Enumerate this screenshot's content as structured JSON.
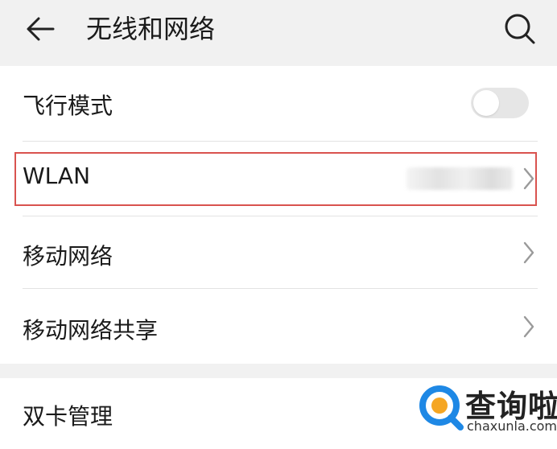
{
  "header": {
    "title": "无线和网络",
    "back_icon": "arrow-left-icon",
    "search_icon": "search-icon"
  },
  "settings": {
    "items": [
      {
        "label": "飞行模式",
        "control": "toggle",
        "toggle_on": false
      },
      {
        "label": "WLAN",
        "control": "chevron",
        "value_obscured": true,
        "highlighted": true
      },
      {
        "label": "移动网络",
        "control": "chevron"
      },
      {
        "label": "移动网络共享",
        "control": "chevron"
      },
      {
        "label": "双卡管理",
        "control": "chevron"
      }
    ]
  },
  "watermark": {
    "name": "查询啦",
    "domain": "chaxunla.com"
  },
  "colors": {
    "page_background": "#f1f1f1",
    "card_background": "#ffffff",
    "highlight_border": "#d9534f",
    "watermark_logo_blue": "#1e88e5",
    "watermark_logo_orange": "#f5a623"
  }
}
